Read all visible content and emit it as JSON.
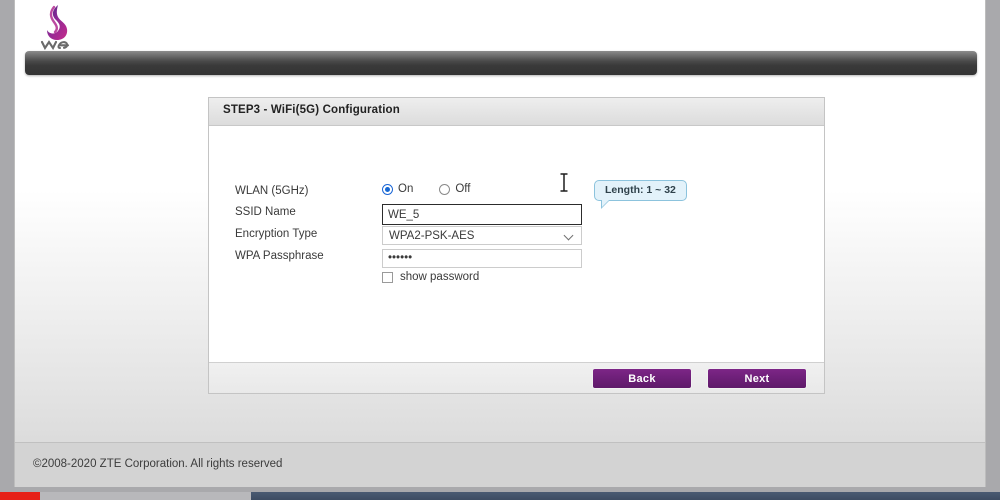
{
  "browser": {
    "logo_alt": "we-logo"
  },
  "panel": {
    "title": "STEP3 - WiFi(5G) Configuration"
  },
  "form": {
    "wlan": {
      "label": "WLAN (5GHz)",
      "option_on": "On",
      "option_off": "Off",
      "selected": "On"
    },
    "ssid": {
      "label": "SSID Name",
      "value": "WE_5",
      "placeholder": ""
    },
    "encryption": {
      "label": "Encryption Type",
      "value": "WPA2-PSK-AES",
      "options": [
        "WPA2-PSK-AES"
      ]
    },
    "passphrase": {
      "label": "WPA Passphrase",
      "value": "••••••",
      "placeholder": ""
    },
    "show_password": {
      "label": "show password",
      "checked": false
    }
  },
  "tooltip": {
    "text": "Length: 1 ~ 32"
  },
  "footer_buttons": {
    "back": "Back",
    "next": "Next"
  },
  "copyright": {
    "text": "©2008-2020 ZTE Corporation. All rights reserved"
  },
  "colors": {
    "brand_purple": "#6d1f78",
    "logo_magenta": "#b02a8f",
    "logo_violet": "#5b2a8a",
    "radio_blue": "#1567d3",
    "tooltip_bg": "#e3f2fa",
    "tooltip_border": "#8cc3dd",
    "navbar_dark": "#3a3a3a",
    "video_progress_red": "#e62117",
    "video_secondary_blue": "#3d4c62"
  }
}
